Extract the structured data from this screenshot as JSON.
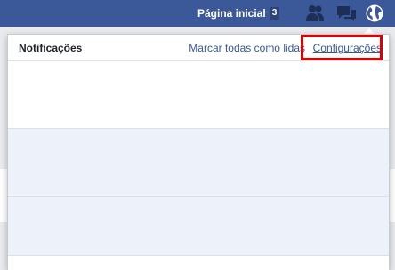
{
  "topbar": {
    "home_label": "Página inicial",
    "home_count": "3",
    "icons": [
      "friends-icon",
      "messages-icon",
      "globe-icon"
    ],
    "background_color": "#3b5998"
  },
  "notifications": {
    "title": "Notificações",
    "mark_all_label": "Marcar todas como lidas",
    "settings_label": "Configurações",
    "highlight_color": "#e00000",
    "unread_color": "#edf2fa"
  }
}
